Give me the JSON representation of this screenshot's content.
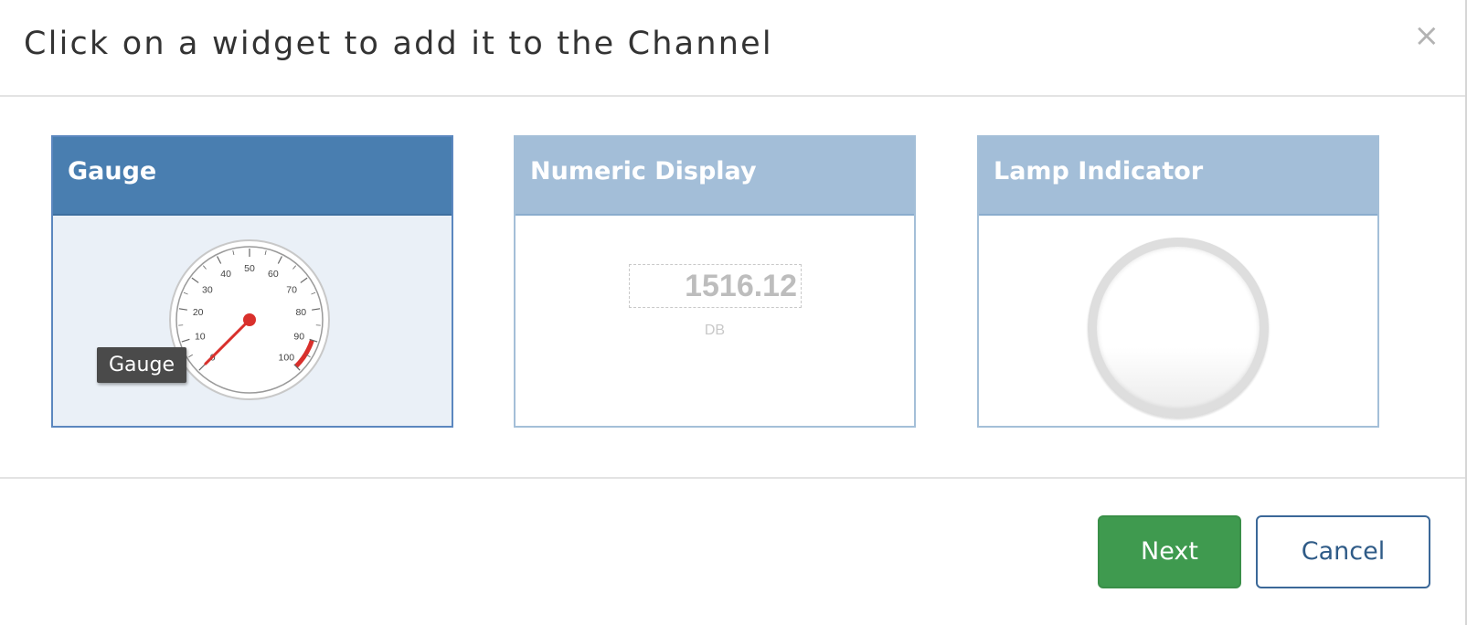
{
  "dialog": {
    "title": "Click on a widget to add it to the Channel",
    "close_glyph": "×"
  },
  "widgets": [
    {
      "title": "Gauge",
      "selected": true,
      "tooltip": "Gauge",
      "gauge": {
        "ticks": [
          "0",
          "10",
          "20",
          "30",
          "40",
          "50",
          "60",
          "70",
          "80",
          "90",
          "100"
        ],
        "value": 0,
        "red_zone_start": 90,
        "needle_color": "#d9302c"
      }
    },
    {
      "title": "Numeric Display",
      "selected": false,
      "value": "1516.12",
      "unit": "DB"
    },
    {
      "title": "Lamp Indicator",
      "selected": false,
      "state": "off"
    }
  ],
  "footer": {
    "next_label": "Next",
    "cancel_label": "Cancel"
  },
  "colors": {
    "selected_header": "#497eb0",
    "unselected_header": "#a3bed8",
    "next_button": "#3f9a4f",
    "cancel_text": "#2f5b87"
  }
}
